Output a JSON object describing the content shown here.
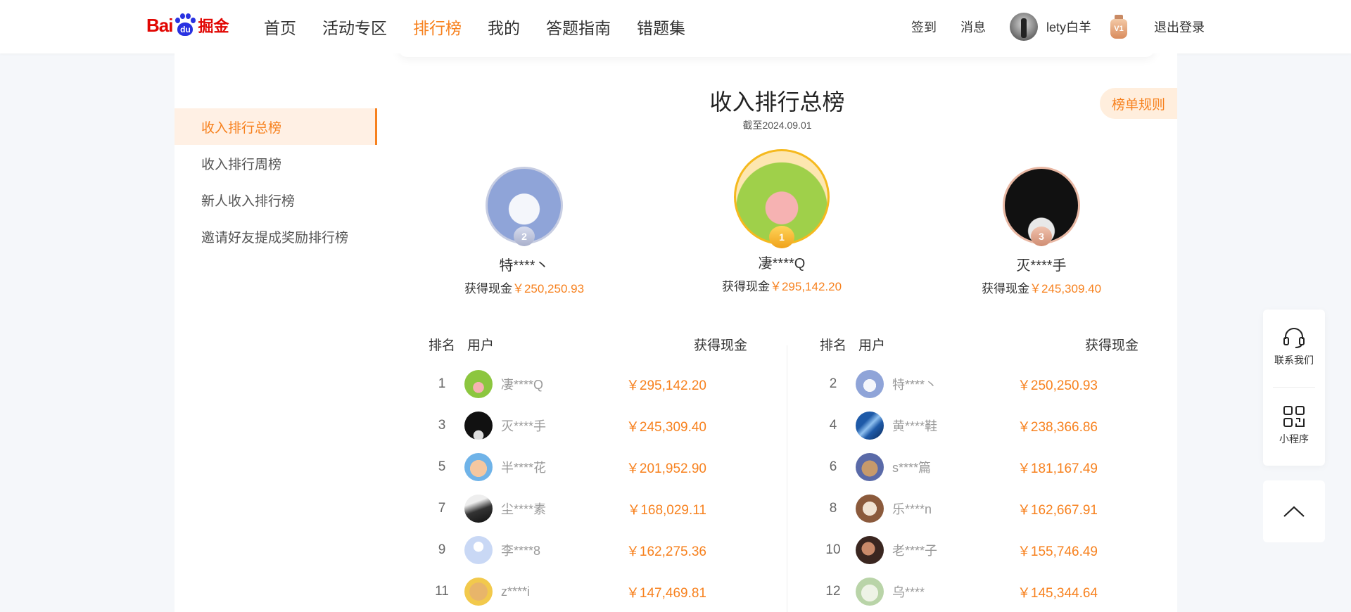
{
  "header": {
    "logo": {
      "bai": "Bai",
      "du": "du",
      "juejin": "掘金"
    },
    "nav": [
      {
        "label": "首页",
        "active": false
      },
      {
        "label": "活动专区",
        "active": false
      },
      {
        "label": "排行榜",
        "active": true
      },
      {
        "label": "我的",
        "active": false
      },
      {
        "label": "答题指南",
        "active": false
      },
      {
        "label": "错题集",
        "active": false
      }
    ],
    "signin": "签到",
    "messages": "消息",
    "username": "lety白羊",
    "vip_badge": "V1",
    "logout": "退出登录"
  },
  "sidebar": {
    "items": [
      {
        "label": "收入排行总榜",
        "active": true
      },
      {
        "label": "收入排行周榜",
        "active": false
      },
      {
        "label": "新人收入排行榜",
        "active": false
      },
      {
        "label": "邀请好友提成奖励排行榜",
        "active": false
      }
    ]
  },
  "main": {
    "title": "收入排行总榜",
    "subtitle": "截至2024.09.01",
    "rules_button": "榜单规则",
    "cash_label": "获得现金",
    "podium": [
      {
        "rank": "2",
        "name": "特****丶",
        "amount": "￥250,250.93"
      },
      {
        "rank": "1",
        "name": "凄****Q",
        "amount": "￥295,142.20"
      },
      {
        "rank": "3",
        "name": "灭****手",
        "amount": "￥245,309.40"
      }
    ],
    "columns": {
      "rank": "排名",
      "user": "用户",
      "cash": "获得现金"
    },
    "left_rows": [
      {
        "rank": "1",
        "name": "凄****Q",
        "amount": "￥295,142.20"
      },
      {
        "rank": "3",
        "name": "灭****手",
        "amount": "￥245,309.40"
      },
      {
        "rank": "5",
        "name": "半****花",
        "amount": "￥201,952.90"
      },
      {
        "rank": "7",
        "name": "尘****素",
        "amount": "￥168,029.11"
      },
      {
        "rank": "9",
        "name": "李****8",
        "amount": "￥162,275.36"
      },
      {
        "rank": "11",
        "name": "z****i",
        "amount": "￥147,469.81"
      }
    ],
    "right_rows": [
      {
        "rank": "2",
        "name": "特****丶",
        "amount": "￥250,250.93"
      },
      {
        "rank": "4",
        "name": "黄****鞋",
        "amount": "￥238,366.86"
      },
      {
        "rank": "6",
        "name": "s****篇",
        "amount": "￥181,167.49"
      },
      {
        "rank": "8",
        "name": "乐****n",
        "amount": "￥162,667.91"
      },
      {
        "rank": "10",
        "name": "老****子",
        "amount": "￥155,746.49"
      },
      {
        "rank": "12",
        "name": "乌****",
        "amount": "￥145,344.64"
      }
    ]
  },
  "float": {
    "contact": "联系我们",
    "miniprogram": "小程序"
  },
  "colors": {
    "accent": "#f7811e",
    "accent_bg": "#fff0e4",
    "gold": "#f5b91e",
    "silver": "#b9bfd6",
    "bronze": "#e2a58a"
  }
}
